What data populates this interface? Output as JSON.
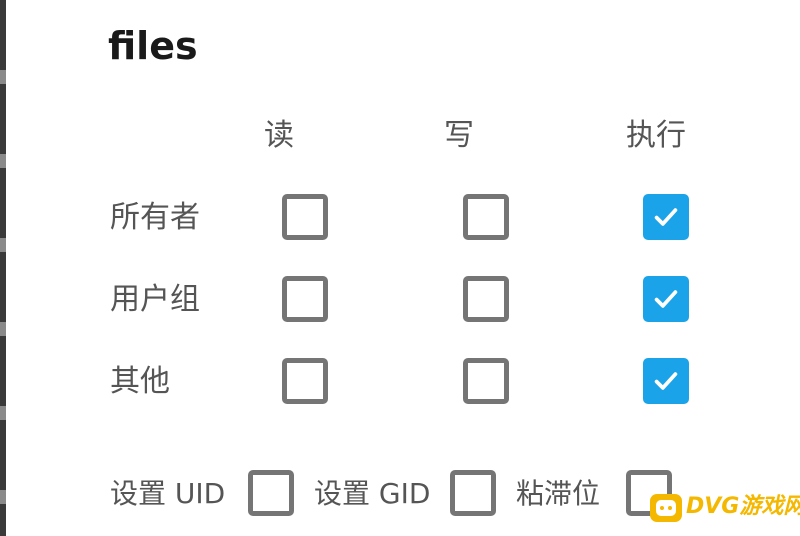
{
  "dialog": {
    "title": "files"
  },
  "columns": [
    "读",
    "写",
    "执行"
  ],
  "rows": [
    {
      "label": "所有者",
      "read": false,
      "write": false,
      "execute": true
    },
    {
      "label": "用户组",
      "read": false,
      "write": false,
      "execute": true
    },
    {
      "label": "其他",
      "read": false,
      "write": false,
      "execute": true
    }
  ],
  "special": [
    {
      "label": "设置 UID",
      "checked": false
    },
    {
      "label": "设置 GID",
      "checked": false
    },
    {
      "label": "粘滞位",
      "checked": false
    }
  ],
  "watermark": {
    "text": "DVG游戏网",
    "icon": "gamepad-icon"
  },
  "colors": {
    "accent": "#1aa3e8",
    "unchecked_border": "#757575",
    "label_text": "#555555",
    "title_text": "#1a1a1a",
    "watermark": "#f5b800"
  }
}
